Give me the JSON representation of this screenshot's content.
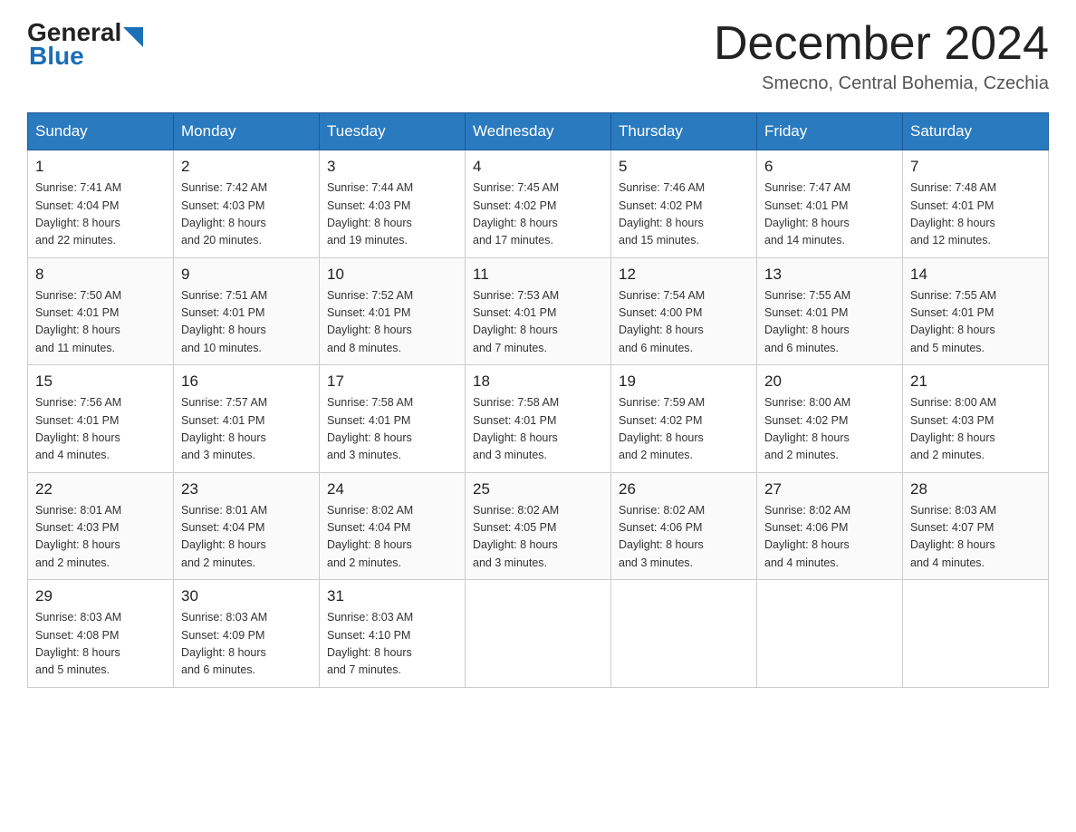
{
  "header": {
    "logo_general": "General",
    "logo_blue": "Blue",
    "month_title": "December 2024",
    "location": "Smecno, Central Bohemia, Czechia"
  },
  "weekdays": [
    "Sunday",
    "Monday",
    "Tuesday",
    "Wednesday",
    "Thursday",
    "Friday",
    "Saturday"
  ],
  "weeks": [
    [
      {
        "day": "1",
        "sunrise": "7:41 AM",
        "sunset": "4:04 PM",
        "daylight": "8 hours and 22 minutes."
      },
      {
        "day": "2",
        "sunrise": "7:42 AM",
        "sunset": "4:03 PM",
        "daylight": "8 hours and 20 minutes."
      },
      {
        "day": "3",
        "sunrise": "7:44 AM",
        "sunset": "4:03 PM",
        "daylight": "8 hours and 19 minutes."
      },
      {
        "day": "4",
        "sunrise": "7:45 AM",
        "sunset": "4:02 PM",
        "daylight": "8 hours and 17 minutes."
      },
      {
        "day": "5",
        "sunrise": "7:46 AM",
        "sunset": "4:02 PM",
        "daylight": "8 hours and 15 minutes."
      },
      {
        "day": "6",
        "sunrise": "7:47 AM",
        "sunset": "4:01 PM",
        "daylight": "8 hours and 14 minutes."
      },
      {
        "day": "7",
        "sunrise": "7:48 AM",
        "sunset": "4:01 PM",
        "daylight": "8 hours and 12 minutes."
      }
    ],
    [
      {
        "day": "8",
        "sunrise": "7:50 AM",
        "sunset": "4:01 PM",
        "daylight": "8 hours and 11 minutes."
      },
      {
        "day": "9",
        "sunrise": "7:51 AM",
        "sunset": "4:01 PM",
        "daylight": "8 hours and 10 minutes."
      },
      {
        "day": "10",
        "sunrise": "7:52 AM",
        "sunset": "4:01 PM",
        "daylight": "8 hours and 8 minutes."
      },
      {
        "day": "11",
        "sunrise": "7:53 AM",
        "sunset": "4:01 PM",
        "daylight": "8 hours and 7 minutes."
      },
      {
        "day": "12",
        "sunrise": "7:54 AM",
        "sunset": "4:00 PM",
        "daylight": "8 hours and 6 minutes."
      },
      {
        "day": "13",
        "sunrise": "7:55 AM",
        "sunset": "4:01 PM",
        "daylight": "8 hours and 6 minutes."
      },
      {
        "day": "14",
        "sunrise": "7:55 AM",
        "sunset": "4:01 PM",
        "daylight": "8 hours and 5 minutes."
      }
    ],
    [
      {
        "day": "15",
        "sunrise": "7:56 AM",
        "sunset": "4:01 PM",
        "daylight": "8 hours and 4 minutes."
      },
      {
        "day": "16",
        "sunrise": "7:57 AM",
        "sunset": "4:01 PM",
        "daylight": "8 hours and 3 minutes."
      },
      {
        "day": "17",
        "sunrise": "7:58 AM",
        "sunset": "4:01 PM",
        "daylight": "8 hours and 3 minutes."
      },
      {
        "day": "18",
        "sunrise": "7:58 AM",
        "sunset": "4:01 PM",
        "daylight": "8 hours and 3 minutes."
      },
      {
        "day": "19",
        "sunrise": "7:59 AM",
        "sunset": "4:02 PM",
        "daylight": "8 hours and 2 minutes."
      },
      {
        "day": "20",
        "sunrise": "8:00 AM",
        "sunset": "4:02 PM",
        "daylight": "8 hours and 2 minutes."
      },
      {
        "day": "21",
        "sunrise": "8:00 AM",
        "sunset": "4:03 PM",
        "daylight": "8 hours and 2 minutes."
      }
    ],
    [
      {
        "day": "22",
        "sunrise": "8:01 AM",
        "sunset": "4:03 PM",
        "daylight": "8 hours and 2 minutes."
      },
      {
        "day": "23",
        "sunrise": "8:01 AM",
        "sunset": "4:04 PM",
        "daylight": "8 hours and 2 minutes."
      },
      {
        "day": "24",
        "sunrise": "8:02 AM",
        "sunset": "4:04 PM",
        "daylight": "8 hours and 2 minutes."
      },
      {
        "day": "25",
        "sunrise": "8:02 AM",
        "sunset": "4:05 PM",
        "daylight": "8 hours and 3 minutes."
      },
      {
        "day": "26",
        "sunrise": "8:02 AM",
        "sunset": "4:06 PM",
        "daylight": "8 hours and 3 minutes."
      },
      {
        "day": "27",
        "sunrise": "8:02 AM",
        "sunset": "4:06 PM",
        "daylight": "8 hours and 4 minutes."
      },
      {
        "day": "28",
        "sunrise": "8:03 AM",
        "sunset": "4:07 PM",
        "daylight": "8 hours and 4 minutes."
      }
    ],
    [
      {
        "day": "29",
        "sunrise": "8:03 AM",
        "sunset": "4:08 PM",
        "daylight": "8 hours and 5 minutes."
      },
      {
        "day": "30",
        "sunrise": "8:03 AM",
        "sunset": "4:09 PM",
        "daylight": "8 hours and 6 minutes."
      },
      {
        "day": "31",
        "sunrise": "8:03 AM",
        "sunset": "4:10 PM",
        "daylight": "8 hours and 7 minutes."
      },
      null,
      null,
      null,
      null
    ]
  ],
  "labels": {
    "sunrise": "Sunrise: ",
    "sunset": "Sunset: ",
    "daylight": "Daylight: "
  }
}
